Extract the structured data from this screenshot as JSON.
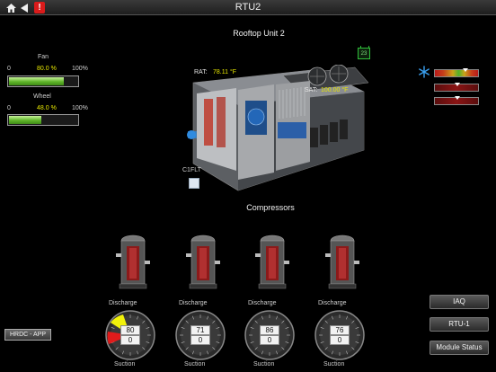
{
  "topbar": {
    "title": "RTU2",
    "home_icon": "home-icon",
    "back_icon": "back-arrow-icon",
    "alarm_label": "!"
  },
  "unit_title": "Rooftop Unit 2",
  "fan": {
    "label": "Fan",
    "min": "0",
    "max": "100%",
    "value_text": "80.0 %",
    "level": 0.8
  },
  "wheel": {
    "label": "Wheel",
    "min": "0",
    "max": "100%",
    "value_text": "48.0 %",
    "level": 0.48
  },
  "readouts": {
    "rat_label": "RAT:",
    "rat_value": "78.11 °F",
    "sat_label": "SAT:",
    "sat_value": "100.00 °F"
  },
  "calendar": {
    "day": "23",
    "icon": "calendar-icon"
  },
  "snow_icon": "snowflake-icon",
  "c1flt_label": "C1FLT",
  "compressors_title": "Compressors",
  "compressors": [
    {
      "discharge_label": "Discharge",
      "discharge": "80",
      "suction": "0",
      "suction_label": "Suction",
      "alarm": true
    },
    {
      "discharge_label": "Discharge",
      "discharge": "71",
      "suction": "0",
      "suction_label": "Suction",
      "alarm": false
    },
    {
      "discharge_label": "Discharge",
      "discharge": "86",
      "suction": "0",
      "suction_label": "Suction",
      "alarm": false
    },
    {
      "discharge_label": "Discharge",
      "discharge": "76",
      "suction": "0",
      "suction_label": "Suction",
      "alarm": false
    }
  ],
  "buttons": {
    "iaq": "IAQ",
    "rtu1": "RTU-1",
    "module_status": "Module Status",
    "hrdc_app": "HRDC - APP"
  },
  "colors": {
    "value_yellow": "#e8e800",
    "fill_green": "#5fb52a",
    "alarm_red": "#d91b1b",
    "snow_blue": "#3aa0f0"
  }
}
